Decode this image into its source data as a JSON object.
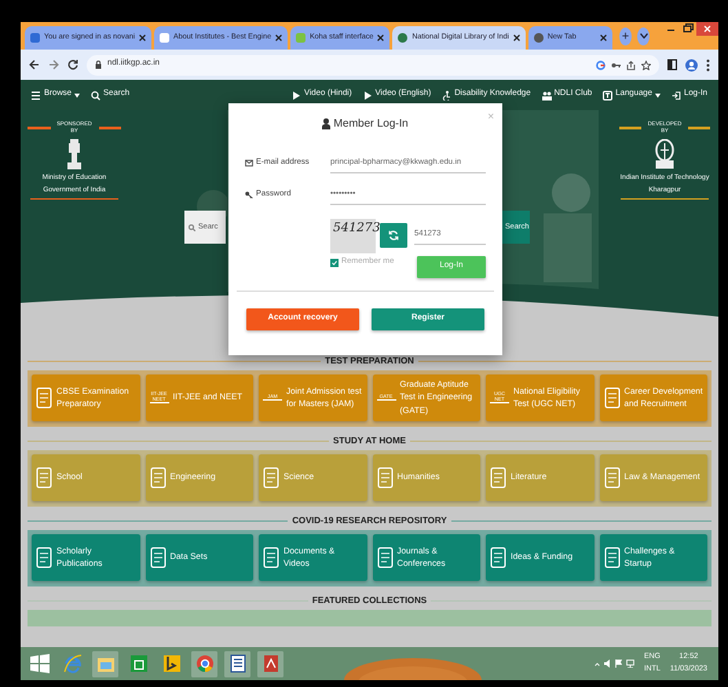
{
  "browser": {
    "tabs": [
      {
        "title": "You are signed in as novani",
        "selected": false
      },
      {
        "title": "About Institutes - Best Engine",
        "selected": false
      },
      {
        "title": "Koha staff interface",
        "selected": false
      },
      {
        "title": "National Digital Library of Indi",
        "selected": true
      },
      {
        "title": "New Tab",
        "selected": false
      }
    ],
    "new_tab": "+",
    "url": "ndl.iitkgp.ac.in"
  },
  "navbar": {
    "left": [
      {
        "label": "Browse",
        "kind": "menu"
      },
      {
        "label": "Search",
        "kind": "search"
      }
    ],
    "right": [
      {
        "label": "Video (Hindi)",
        "kind": "play"
      },
      {
        "label": "Video (English)",
        "kind": "play"
      },
      {
        "label": "Disability Knowledge",
        "kind": "access"
      },
      {
        "label": "NDLI Club",
        "kind": "club"
      },
      {
        "label": "Language",
        "kind": "language"
      },
      {
        "label": "Log-In",
        "kind": "login"
      }
    ]
  },
  "hero": {
    "sponsor": {
      "caption": "SPONSORED BY",
      "lines": [
        "Ministry of Education",
        "Government of India"
      ]
    },
    "developer": {
      "caption": "DEVELOPED BY",
      "lines": [
        "Indian Institute of Technology",
        "Kharagpur"
      ]
    },
    "search_placeholder": "Searc",
    "search_button": "Search"
  },
  "modal": {
    "title": "Member Log-In",
    "close": "×",
    "email_label": "E-mail address",
    "email_value": "principal-bpharmacy@kkwagh.edu.in",
    "password_label": "Password",
    "password_value": "•••••••••",
    "captcha": "541273",
    "captcha_value": "541273",
    "remember_label": "Remember me",
    "remember_checked": true,
    "login": "Log-In",
    "recovery": "Account recovery",
    "register": "Register"
  },
  "sections": [
    {
      "title": "TEST PREPARATION",
      "color": "#cf8a0c",
      "items": [
        {
          "label": "CBSE Examination Preparatory"
        },
        {
          "label": "IIT-JEE and NEET",
          "icon_text": "IIT-JEE NEET"
        },
        {
          "label": "Joint Admission test for Masters (JAM)",
          "icon_text": "JAM"
        },
        {
          "label": "Graduate Aptitude Test in Engineering (GATE)",
          "icon_text": "GATE"
        },
        {
          "label": "National Eligibility Test (UGC NET)",
          "icon_text": "UGC NET"
        },
        {
          "label": "Career Development and Recruitment"
        }
      ]
    },
    {
      "title": "STUDY AT HOME",
      "color": "#b9a03a",
      "items": [
        {
          "label": "School"
        },
        {
          "label": "Engineering"
        },
        {
          "label": "Science"
        },
        {
          "label": "Humanities"
        },
        {
          "label": "Literature"
        },
        {
          "label": "Law & Management"
        }
      ]
    },
    {
      "title": "COVID-19 RESEARCH REPOSITORY",
      "color": "#0e8572",
      "items": [
        {
          "label": "Scholarly Publications"
        },
        {
          "label": "Data Sets"
        },
        {
          "label": "Documents & Videos"
        },
        {
          "label": "Journals & Conferences"
        },
        {
          "label": "Ideas & Funding"
        },
        {
          "label": "Challenges & Startup"
        }
      ]
    },
    {
      "title": "FEATURED COLLECTIONS",
      "color": "#9cc0a0"
    }
  ],
  "taskbar": {
    "language": "ENG",
    "layout": "INTL",
    "time": "12:52",
    "date": "11/03/2023"
  }
}
